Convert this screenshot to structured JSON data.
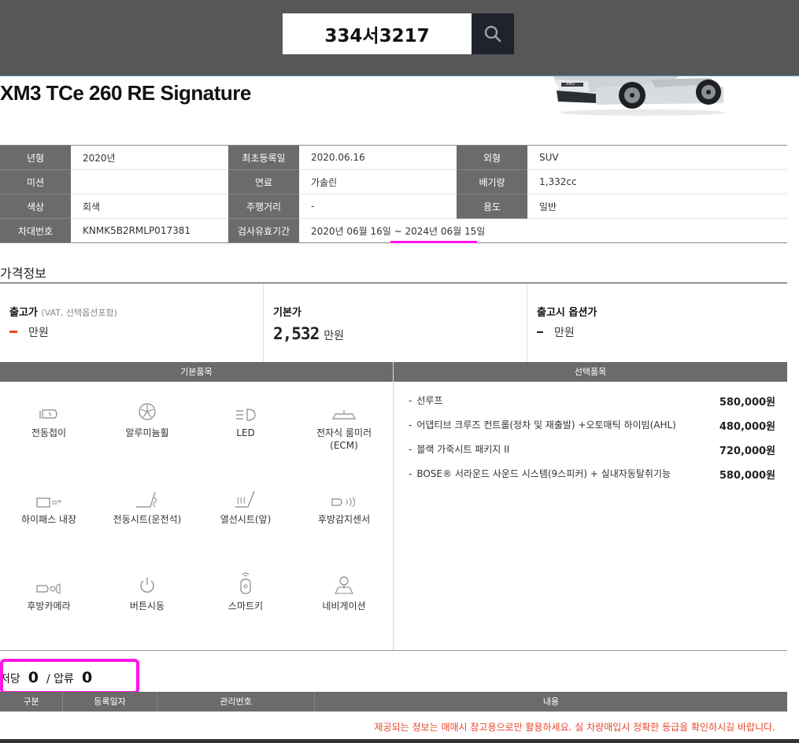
{
  "search": {
    "value": "334서3217"
  },
  "car": {
    "title": "XM3 TCe 260 RE Signature",
    "badge": "XM3"
  },
  "specs": [
    [
      {
        "k": "년형",
        "v": "2020년"
      },
      {
        "k": "최초등록일",
        "v": "2020.06.16"
      },
      {
        "k": "외형",
        "v": "SUV"
      }
    ],
    [
      {
        "k": "미션",
        "v": ""
      },
      {
        "k": "연료",
        "v": "가솔린"
      },
      {
        "k": "배기량",
        "v": "1,332cc"
      }
    ],
    [
      {
        "k": "색상",
        "v": "회색"
      },
      {
        "k": "주행거리",
        "v": "-"
      },
      {
        "k": "용도",
        "v": "일반"
      }
    ],
    [
      {
        "k": "차대번호",
        "v": "KNMK5B2RMLP017381"
      },
      {
        "k": "검사유효기간",
        "v": "2020년 06월 16일 ~ 2024년 06월 15일"
      }
    ]
  ],
  "price": {
    "title": "가격정보",
    "release": {
      "label": "출고가",
      "sub": "(VAT, 선택옵션포함)",
      "value": "",
      "unit": "만원"
    },
    "base": {
      "label": "기본가",
      "value": "2,532",
      "unit": "만원"
    },
    "option": {
      "label": "출고시 옵션가",
      "value": "",
      "unit": "만원"
    }
  },
  "options": {
    "basic_title": "기본품목",
    "select_title": "선택품목",
    "basic": [
      {
        "label": "전동접이",
        "icon": "mirror-fold-icon"
      },
      {
        "label": "알루미늄휠",
        "icon": "alloy-wheel-icon"
      },
      {
        "label": "LED",
        "icon": "led-headlamp-icon"
      },
      {
        "label": "전자식 룸미러\n(ECM)",
        "icon": "room-mirror-icon"
      },
      {
        "label": "하이패스 내장",
        "icon": "hipass-icon"
      },
      {
        "label": "전동시트(운전석)",
        "icon": "power-seat-icon"
      },
      {
        "label": "열선시트(앞)",
        "icon": "heated-seat-icon"
      },
      {
        "label": "후방감지센서",
        "icon": "rear-sensor-icon"
      },
      {
        "label": "후방카메라",
        "icon": "rear-camera-icon"
      },
      {
        "label": "버튼시동",
        "icon": "power-button-icon"
      },
      {
        "label": "스마트키",
        "icon": "smart-key-icon"
      },
      {
        "label": "네비게이션",
        "icon": "navigation-icon"
      }
    ],
    "selected": [
      {
        "name": "선루프",
        "price": "580,000원"
      },
      {
        "name": "어댑티브 크루즈 컨트롤(정차 및 재출발) +오토매틱 하이빔(AHL)",
        "price": "480,000원"
      },
      {
        "name": "블랙 가죽시트 패키지 II",
        "price": "720,000원"
      },
      {
        "name": "BOSE® 서라운드 사운드 시스템(9스피커) + 실내자동탈취기능",
        "price": "580,000원"
      }
    ]
  },
  "lien": {
    "mortgage_label": "저당",
    "mortgage_count": "0",
    "seizure_label": "/ 압류",
    "seizure_count": "0"
  },
  "registry": {
    "columns": [
      "구분",
      "등록일자",
      "관리번호",
      "내용"
    ]
  },
  "notice": "제공되는 정보는 매매시 참고용으로만 활용하세요. 실 차량매입시 정확한 등급을 확인하시길 바랍니다."
}
